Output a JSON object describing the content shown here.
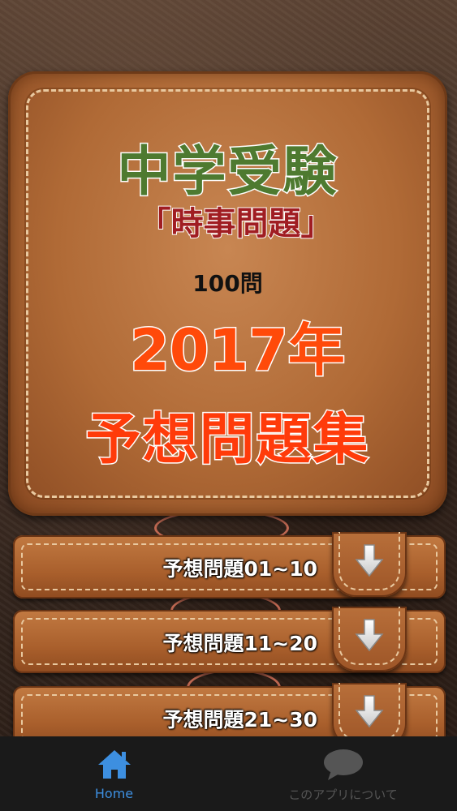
{
  "panel": {
    "title": "中学受験",
    "subtitle": "「時事問題」",
    "count": "100問",
    "year": "2017年",
    "collection": "予想問題集"
  },
  "list": [
    {
      "label": "予想問題01~10",
      "icon": "download-arrow-icon"
    },
    {
      "label": "予想問題11~20",
      "icon": "download-arrow-icon"
    },
    {
      "label": "予想問題21~30",
      "icon": "download-arrow-icon"
    }
  ],
  "nav": {
    "home": {
      "label": "Home",
      "icon": "home-icon",
      "color": "#3d8fe0",
      "active": true
    },
    "about": {
      "label": "このアプリについて",
      "icon": "chat-bubble-icon",
      "color": "#555555",
      "active": false
    }
  },
  "colors": {
    "title_green": "#4e7a30",
    "subtitle_red": "#a01d22",
    "year_orange": "#ff4a0a",
    "leather_brown": "#b06a36",
    "nav_bg": "#1a1a1a"
  }
}
